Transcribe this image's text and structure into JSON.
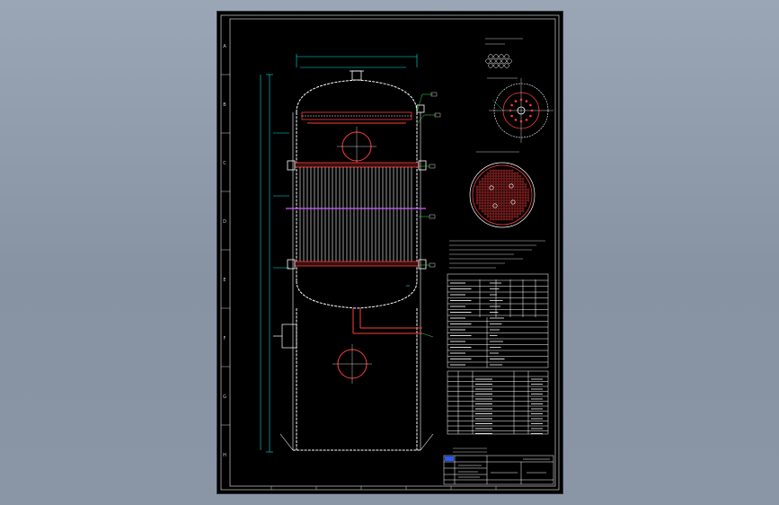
{
  "drawing": {
    "background": "#000000",
    "colors": {
      "outline": "#ffffff",
      "dimension": "#00e5e5",
      "tube": "#ff3b3b",
      "leader": "#2ee85a",
      "pipe": "#d25cff",
      "border": "#cfcfcf"
    },
    "zone_letters": [
      "A",
      "B",
      "C",
      "D",
      "E",
      "F",
      "G",
      "H"
    ],
    "zone_numbers": [
      "1",
      "2",
      "3",
      "4",
      "5",
      "6",
      "7",
      "8"
    ]
  }
}
